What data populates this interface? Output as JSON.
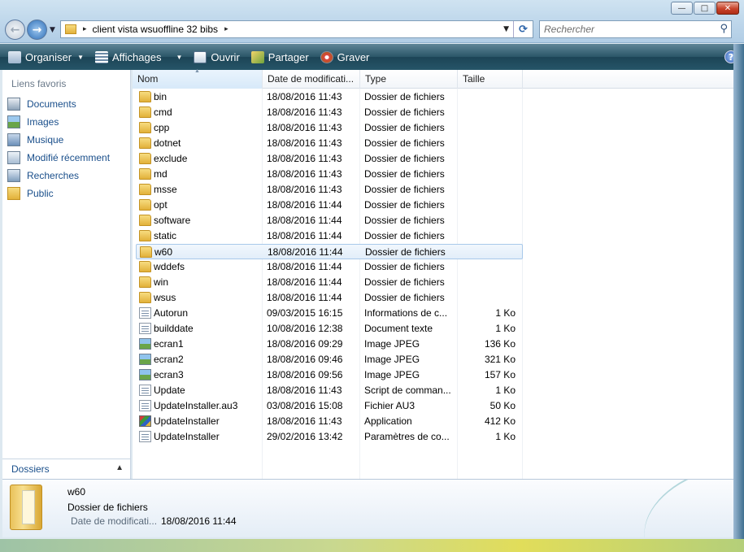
{
  "window": {
    "minimize_glyph": "—",
    "maximize_glyph": "□",
    "close_glyph": "✕"
  },
  "address_bar": {
    "path_label": "client vista wsuoffline 32 bibs",
    "separator": "▸",
    "dropdown": "▼",
    "refresh": "⟳"
  },
  "search": {
    "placeholder": "Rechercher"
  },
  "command_bar": {
    "organize": "Organiser",
    "views": "Affichages",
    "open": "Ouvrir",
    "share": "Partager",
    "burn": "Graver",
    "help": "?"
  },
  "nav_pane": {
    "title": "Liens favoris",
    "items": [
      {
        "label": "Documents",
        "icon": "documents-icon"
      },
      {
        "label": "Images",
        "icon": "images-icon"
      },
      {
        "label": "Musique",
        "icon": "music-icon"
      },
      {
        "label": "Modifié récemment",
        "icon": "recent-icon"
      },
      {
        "label": "Recherches",
        "icon": "searches-icon"
      },
      {
        "label": "Public",
        "icon": "public-folder-icon"
      }
    ],
    "folders_label": "Dossiers"
  },
  "columns": {
    "name": "Nom",
    "date": "Date de modificati...",
    "type": "Type",
    "size": "Taille"
  },
  "files": [
    {
      "name": "bin",
      "date": "18/08/2016 11:43",
      "type": "Dossier de fichiers",
      "size": "",
      "icon": "folder"
    },
    {
      "name": "cmd",
      "date": "18/08/2016 11:43",
      "type": "Dossier de fichiers",
      "size": "",
      "icon": "folder"
    },
    {
      "name": "cpp",
      "date": "18/08/2016 11:43",
      "type": "Dossier de fichiers",
      "size": "",
      "icon": "folder"
    },
    {
      "name": "dotnet",
      "date": "18/08/2016 11:43",
      "type": "Dossier de fichiers",
      "size": "",
      "icon": "folder"
    },
    {
      "name": "exclude",
      "date": "18/08/2016 11:43",
      "type": "Dossier de fichiers",
      "size": "",
      "icon": "folder"
    },
    {
      "name": "md",
      "date": "18/08/2016 11:43",
      "type": "Dossier de fichiers",
      "size": "",
      "icon": "folder"
    },
    {
      "name": "msse",
      "date": "18/08/2016 11:43",
      "type": "Dossier de fichiers",
      "size": "",
      "icon": "folder"
    },
    {
      "name": "opt",
      "date": "18/08/2016 11:44",
      "type": "Dossier de fichiers",
      "size": "",
      "icon": "folder"
    },
    {
      "name": "software",
      "date": "18/08/2016 11:44",
      "type": "Dossier de fichiers",
      "size": "",
      "icon": "folder"
    },
    {
      "name": "static",
      "date": "18/08/2016 11:44",
      "type": "Dossier de fichiers",
      "size": "",
      "icon": "folder"
    },
    {
      "name": "w60",
      "date": "18/08/2016 11:44",
      "type": "Dossier de fichiers",
      "size": "",
      "icon": "folder",
      "selected": true
    },
    {
      "name": "wddefs",
      "date": "18/08/2016 11:44",
      "type": "Dossier de fichiers",
      "size": "",
      "icon": "folder"
    },
    {
      "name": "win",
      "date": "18/08/2016 11:44",
      "type": "Dossier de fichiers",
      "size": "",
      "icon": "folder"
    },
    {
      "name": "wsus",
      "date": "18/08/2016 11:44",
      "type": "Dossier de fichiers",
      "size": "",
      "icon": "folder"
    },
    {
      "name": "Autorun",
      "date": "09/03/2015 16:15",
      "type": "Informations de c...",
      "size": "1 Ko",
      "icon": "file"
    },
    {
      "name": "builddate",
      "date": "10/08/2016 12:38",
      "type": "Document texte",
      "size": "1 Ko",
      "icon": "file"
    },
    {
      "name": "ecran1",
      "date": "18/08/2016 09:29",
      "type": "Image JPEG",
      "size": "136 Ko",
      "icon": "image"
    },
    {
      "name": "ecran2",
      "date": "18/08/2016 09:46",
      "type": "Image JPEG",
      "size": "321 Ko",
      "icon": "image"
    },
    {
      "name": "ecran3",
      "date": "18/08/2016 09:56",
      "type": "Image JPEG",
      "size": "157 Ko",
      "icon": "image"
    },
    {
      "name": "Update",
      "date": "18/08/2016 11:43",
      "type": "Script de comman...",
      "size": "1 Ko",
      "icon": "file"
    },
    {
      "name": "UpdateInstaller.au3",
      "date": "03/08/2016 15:08",
      "type": "Fichier AU3",
      "size": "50 Ko",
      "icon": "file"
    },
    {
      "name": "UpdateInstaller",
      "date": "18/08/2016 11:43",
      "type": "Application",
      "size": "412 Ko",
      "icon": "app"
    },
    {
      "name": "UpdateInstaller",
      "date": "29/02/2016 13:42",
      "type": "Paramètres de co...",
      "size": "1 Ko",
      "icon": "file"
    }
  ],
  "details": {
    "name": "w60",
    "type": "Dossier de fichiers",
    "date_label": "Date de modificati...",
    "date_value": "18/08/2016 11:44"
  }
}
